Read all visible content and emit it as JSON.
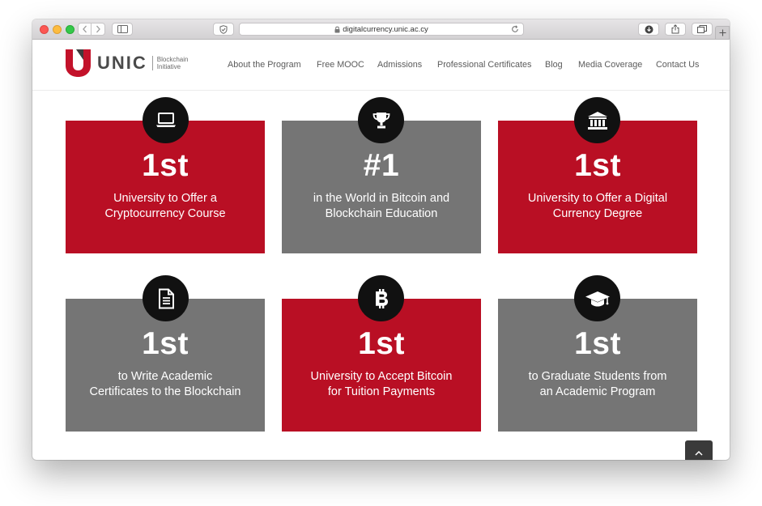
{
  "browser": {
    "url": "digitalcurrency.unic.ac.cy"
  },
  "logo": {
    "wordmark": "UNIC",
    "subtitle_line1": "Blockchain",
    "subtitle_line2": "Initiative"
  },
  "nav": {
    "items": [
      {
        "label": "About the Program"
      },
      {
        "label": "Free MOOC"
      },
      {
        "label": "Admissions"
      },
      {
        "label": "Professional Certificates"
      },
      {
        "label": "Blog"
      },
      {
        "label": "Media Coverage"
      },
      {
        "label": "Contact Us"
      }
    ]
  },
  "cards": [
    {
      "stat": "1st",
      "line1": "University to Offer a",
      "line2": "Cryptocurrency Course",
      "icon": "laptop-icon",
      "color": "#b90f24"
    },
    {
      "stat": "#1",
      "line1": "in the World in Bitcoin and",
      "line2": "Blockchain Education",
      "icon": "trophy-icon",
      "color": "#757575"
    },
    {
      "stat": "1st",
      "line1": "University to Offer a Digital",
      "line2": "Currency Degree",
      "icon": "bank-icon",
      "color": "#b90f24"
    },
    {
      "stat": "1st",
      "line1": "to Write Academic",
      "line2": "Certificates to the Blockchain",
      "icon": "document-icon",
      "color": "#757575"
    },
    {
      "stat": "1st",
      "line1": "University to Accept Bitcoin",
      "line2": "for Tuition Payments",
      "icon": "bitcoin-icon",
      "color": "#b90f24"
    },
    {
      "stat": "1st",
      "line1": "to Graduate Students from",
      "line2": "an Academic Program",
      "icon": "graduation-cap-icon",
      "color": "#757575"
    }
  ],
  "colors": {
    "brand_red": "#b90f24",
    "card_gray": "#757575",
    "badge_black": "#111111"
  }
}
